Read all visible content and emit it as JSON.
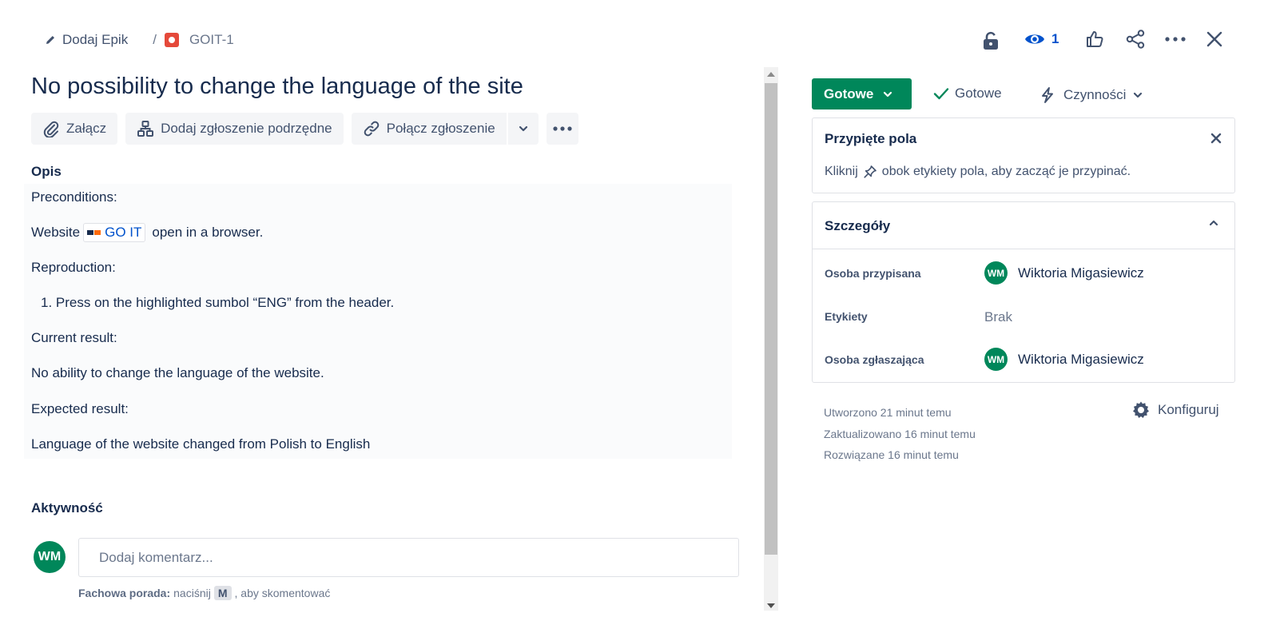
{
  "breadcrumb": {
    "epic_label": "Dodaj Epik",
    "separator": "/",
    "issue_key": "GOIT-1"
  },
  "header_actions": {
    "watch_count": "1"
  },
  "issue": {
    "title": "No possibility to change the language of the site"
  },
  "toolbar": {
    "attach": "Załącz",
    "add_child": "Dodaj zgłoszenie podrzędne",
    "link_issue": "Połącz zgłoszenie"
  },
  "description": {
    "label": "Opis",
    "preconditions": "Preconditions:",
    "website_prefix": "Website",
    "website_link": "GO IT",
    "website_suffix": "open in a browser.",
    "reproduction": "Reproduction:",
    "step_1": "1. Press on the highlighted sumbol “ENG” from the header.",
    "current_label": "Current result:",
    "current_text": "No ability to change the language of the website.",
    "expected_label": "Expected result:",
    "expected_text": "Language of the website changed from Polish to English"
  },
  "activity": {
    "label": "Aktywność",
    "avatar_initials": "WM",
    "comment_placeholder": "Dodaj komentarz...",
    "tip_bold": "Fachowa porada:",
    "tip_pre": "naciśnij",
    "tip_key": "M",
    "tip_post": ", aby skomentować"
  },
  "status": {
    "button_label": "Gotowe",
    "resolution_label": "Gotowe",
    "actions_label": "Czynności",
    "status_color": "#00875a"
  },
  "pinned_fields": {
    "title": "Przypięte pola",
    "hint_pre": "Kliknij",
    "hint_post": "obok etykiety pola, aby zacząć je przypinać."
  },
  "details": {
    "title": "Szczegóły",
    "assignee_label": "Osoba przypisana",
    "assignee_initials": "WM",
    "assignee_name": "Wiktoria Migasiewicz",
    "labels_label": "Etykiety",
    "labels_value": "Brak",
    "reporter_label": "Osoba zgłaszająca",
    "reporter_initials": "WM",
    "reporter_name": "Wiktoria Migasiewicz"
  },
  "meta": {
    "created": "Utworzono 21 minut temu",
    "updated": "Zaktualizowano 16 minut temu",
    "resolved": "Rozwiązane 16 minut temu",
    "configure": "Konfiguruj"
  },
  "icons": {
    "edit": "pencil-icon",
    "issue_type": "bug-icon",
    "lock": "lock-icon",
    "watch": "eye-icon",
    "like": "thumbs-up-icon",
    "share": "share-icon",
    "more": "more-icon",
    "close": "close-icon",
    "attach": "paperclip-icon",
    "child": "hierarchy-icon",
    "link": "link-icon",
    "check": "check-icon",
    "lightning": "lightning-icon",
    "pin": "pin-icon",
    "gear": "gear-icon"
  }
}
